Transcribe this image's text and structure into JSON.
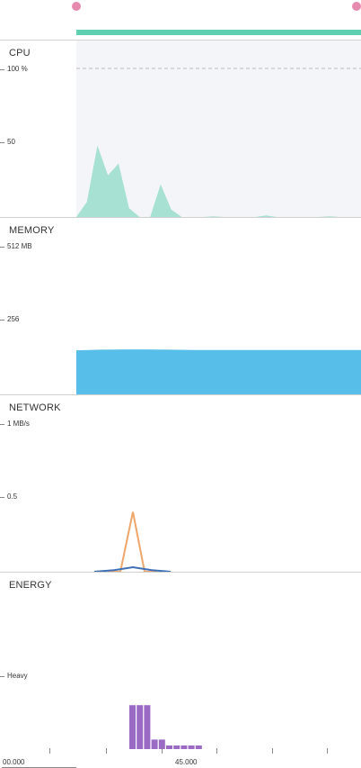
{
  "colors": {
    "cpu_fill": "#a6e1d3",
    "memory_fill": "#57bde9",
    "network_sent": "#f0a66a",
    "network_received": "#3f6fb6",
    "energy_bar": "#9b6ac4",
    "session": "#5fd0b2",
    "marker": "#e68ab0"
  },
  "cpu": {
    "title": "CPU",
    "tick_top": "100 %",
    "tick_mid": "50"
  },
  "memory": {
    "title": "MEMORY",
    "tick_top": "512 MB",
    "tick_mid": "256"
  },
  "network": {
    "title": "NETWORK",
    "tick_top": "1 MB/s",
    "tick_mid": "0.5"
  },
  "energy": {
    "title": "ENERGY",
    "tick_mid": "Heavy"
  },
  "timeline": {
    "start_label": "00.000",
    "mid_label": "45.000"
  },
  "chart_data": [
    {
      "type": "area",
      "series": [
        {
          "values": [
            0,
            10,
            48,
            28,
            36,
            6,
            0,
            0,
            22,
            5,
            0,
            0,
            0,
            0.5,
            0,
            0,
            0,
            0,
            1,
            0,
            0,
            0,
            0,
            0,
            0.5,
            0,
            0,
            0
          ]
        }
      ],
      "ylim": [
        0,
        100
      ]
    },
    {
      "type": "area",
      "series": [
        {
          "values": [
            154,
            156,
            157,
            157,
            156,
            155,
            155,
            155,
            155,
            155,
            155,
            155,
            155
          ]
        }
      ],
      "ylim": [
        0,
        512
      ]
    },
    {
      "type": "line",
      "series": [
        {
          "values": [
            0,
            0,
            0.4,
            0,
            0
          ]
        },
        {
          "values": [
            0,
            0.01,
            0.03,
            0.01,
            0
          ]
        }
      ],
      "ylim": [
        0,
        1
      ]
    },
    {
      "type": "bar",
      "values": [
        3,
        3,
        3,
        0.7,
        0.7,
        0.3,
        0.3,
        0.3,
        0.3,
        0.3
      ],
      "ylim": [
        0,
        10
      ]
    }
  ]
}
